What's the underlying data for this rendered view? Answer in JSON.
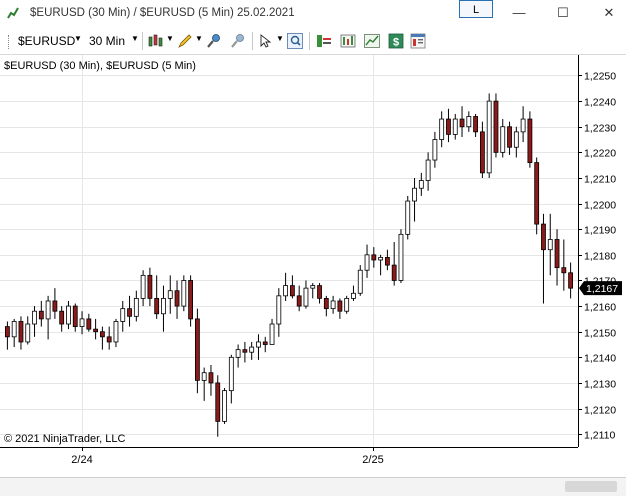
{
  "window": {
    "title": "$EURUSD (30 Min) / $EURUSD (5 Min)  25.02.2021",
    "link_label": "L",
    "minimize_glyph": "—",
    "maximize_glyph": "☐",
    "close_glyph": "✕"
  },
  "toolbar": {
    "instrument": "$EURUSD",
    "interval": "30 Min",
    "icons": [
      "chart-style-icon",
      "drawing-tools-icon",
      "zoom-in-icon",
      "zoom-out-icon",
      "cursor-icon",
      "magnifier-icon",
      "data-box-icon",
      "strategies-icon",
      "chart-trader-icon",
      "dollar-icon",
      "properties-icon"
    ]
  },
  "panel": {
    "title": "$EURUSD (30 Min), $EURUSD (5 Min)",
    "copyright": "© 2021 NinjaTrader, LLC"
  },
  "chart_data": {
    "type": "ohlc",
    "ylim": [
      1.2105,
      1.2258
    ],
    "y_ticks": [
      "1,2250",
      "1,2240",
      "1,2230",
      "1,2220",
      "1,2210",
      "1,2200",
      "1,2190",
      "1,2180",
      "1,2170",
      "1,2160",
      "1,2150",
      "1,2140",
      "1,2130",
      "1,2120",
      "1,2110"
    ],
    "x_ticks": [
      "2/24",
      "2/25"
    ],
    "last_price": "1,2167",
    "colors": {
      "up": "#000000",
      "down": "#8b1a1a",
      "grid": "#e6e6e6",
      "axis": "#000000",
      "price_box": "#000000"
    },
    "bars": [
      [
        1.2152,
        1.2154,
        1.2143,
        1.2148
      ],
      [
        1.2148,
        1.2155,
        1.2144,
        1.2154
      ],
      [
        1.2154,
        1.2156,
        1.2143,
        1.2146
      ],
      [
        1.2146,
        1.2156,
        1.2145,
        1.2153
      ],
      [
        1.2153,
        1.216,
        1.2148,
        1.2158
      ],
      [
        1.2158,
        1.2162,
        1.2152,
        1.2155
      ],
      [
        1.2155,
        1.2164,
        1.2147,
        1.2162
      ],
      [
        1.2162,
        1.2167,
        1.2155,
        1.2158
      ],
      [
        1.2158,
        1.216,
        1.215,
        1.2153
      ],
      [
        1.2153,
        1.2162,
        1.2151,
        1.216
      ],
      [
        1.216,
        1.2161,
        1.215,
        1.2152
      ],
      [
        1.2152,
        1.2158,
        1.2149,
        1.2155
      ],
      [
        1.2155,
        1.2157,
        1.215,
        1.2151
      ],
      [
        1.2151,
        1.2155,
        1.2147,
        1.215
      ],
      [
        1.215,
        1.2152,
        1.2143,
        1.2148
      ],
      [
        1.2148,
        1.2152,
        1.2143,
        1.2146
      ],
      [
        1.2146,
        1.2155,
        1.2144,
        1.2154
      ],
      [
        1.2154,
        1.2162,
        1.215,
        1.2159
      ],
      [
        1.2159,
        1.2164,
        1.2152,
        1.2156
      ],
      [
        1.2156,
        1.2166,
        1.2154,
        1.2163
      ],
      [
        1.2163,
        1.2174,
        1.216,
        1.2172
      ],
      [
        1.2172,
        1.2175,
        1.216,
        1.2163
      ],
      [
        1.2163,
        1.2172,
        1.2155,
        1.2157
      ],
      [
        1.2157,
        1.2168,
        1.215,
        1.2163
      ],
      [
        1.2163,
        1.2172,
        1.2157,
        1.2166
      ],
      [
        1.2166,
        1.217,
        1.2155,
        1.216
      ],
      [
        1.216,
        1.2172,
        1.2158,
        1.217
      ],
      [
        1.217,
        1.2172,
        1.2152,
        1.2155
      ],
      [
        1.2155,
        1.2159,
        1.2126,
        1.2131
      ],
      [
        1.2131,
        1.2136,
        1.2123,
        1.2134
      ],
      [
        1.2134,
        1.2137,
        1.2125,
        1.213
      ],
      [
        1.213,
        1.2133,
        1.2109,
        1.2115
      ],
      [
        1.2115,
        1.2128,
        1.2114,
        1.2127
      ],
      [
        1.2127,
        1.2141,
        1.2122,
        1.214
      ],
      [
        1.214,
        1.2145,
        1.2136,
        1.2143
      ],
      [
        1.2143,
        1.2146,
        1.2138,
        1.2142
      ],
      [
        1.2142,
        1.2146,
        1.2139,
        1.2144
      ],
      [
        1.2144,
        1.2149,
        1.2139,
        1.2146
      ],
      [
        1.2146,
        1.2148,
        1.2142,
        1.2145
      ],
      [
        1.2145,
        1.2155,
        1.2145,
        1.2153
      ],
      [
        1.2153,
        1.2167,
        1.2148,
        1.2164
      ],
      [
        1.2164,
        1.2173,
        1.2162,
        1.2168
      ],
      [
        1.2168,
        1.2172,
        1.2163,
        1.2164
      ],
      [
        1.2164,
        1.2168,
        1.2158,
        1.216
      ],
      [
        1.216,
        1.217,
        1.2159,
        1.2167
      ],
      [
        1.2167,
        1.2169,
        1.2163,
        1.2168
      ],
      [
        1.2168,
        1.2169,
        1.2161,
        1.2163
      ],
      [
        1.2163,
        1.2164,
        1.2156,
        1.2159
      ],
      [
        1.2159,
        1.2164,
        1.2157,
        1.2162
      ],
      [
        1.2162,
        1.2163,
        1.2155,
        1.2158
      ],
      [
        1.2158,
        1.2164,
        1.2157,
        1.2163
      ],
      [
        1.2163,
        1.2168,
        1.2162,
        1.2165
      ],
      [
        1.2165,
        1.2176,
        1.2164,
        1.2174
      ],
      [
        1.2174,
        1.2184,
        1.2171,
        1.218
      ],
      [
        1.218,
        1.2183,
        1.2175,
        1.2178
      ],
      [
        1.2178,
        1.218,
        1.2172,
        1.2179
      ],
      [
        1.2179,
        1.2182,
        1.2174,
        1.2176
      ],
      [
        1.2176,
        1.2185,
        1.2168,
        1.217
      ],
      [
        1.217,
        1.219,
        1.2169,
        1.2188
      ],
      [
        1.2188,
        1.2203,
        1.2186,
        1.2201
      ],
      [
        1.2201,
        1.221,
        1.2193,
        1.2206
      ],
      [
        1.2206,
        1.2212,
        1.2203,
        1.2209
      ],
      [
        1.2209,
        1.222,
        1.2205,
        1.2217
      ],
      [
        1.2217,
        1.2228,
        1.2214,
        1.2225
      ],
      [
        1.2225,
        1.2236,
        1.2222,
        1.2233
      ],
      [
        1.2233,
        1.2237,
        1.2224,
        1.2227
      ],
      [
        1.2227,
        1.2235,
        1.2225,
        1.2233
      ],
      [
        1.2233,
        1.2238,
        1.2226,
        1.223
      ],
      [
        1.223,
        1.2236,
        1.2228,
        1.2234
      ],
      [
        1.2234,
        1.2235,
        1.2226,
        1.2228
      ],
      [
        1.2228,
        1.2232,
        1.221,
        1.2212
      ],
      [
        1.2212,
        1.2243,
        1.221,
        1.224
      ],
      [
        1.224,
        1.2243,
        1.2218,
        1.222
      ],
      [
        1.222,
        1.2233,
        1.2218,
        1.223
      ],
      [
        1.223,
        1.2232,
        1.2219,
        1.2222
      ],
      [
        1.2222,
        1.223,
        1.2218,
        1.2228
      ],
      [
        1.2228,
        1.2238,
        1.2224,
        1.2233
      ],
      [
        1.2233,
        1.2236,
        1.2214,
        1.2216
      ],
      [
        1.2216,
        1.2218,
        1.2188,
        1.2192
      ],
      [
        1.2192,
        1.2196,
        1.2161,
        1.2182
      ],
      [
        1.2182,
        1.2196,
        1.2172,
        1.2186
      ],
      [
        1.2186,
        1.219,
        1.2168,
        1.2175
      ],
      [
        1.2175,
        1.2186,
        1.2166,
        1.2173
      ],
      [
        1.2173,
        1.2177,
        1.2163,
        1.2167
      ]
    ]
  }
}
